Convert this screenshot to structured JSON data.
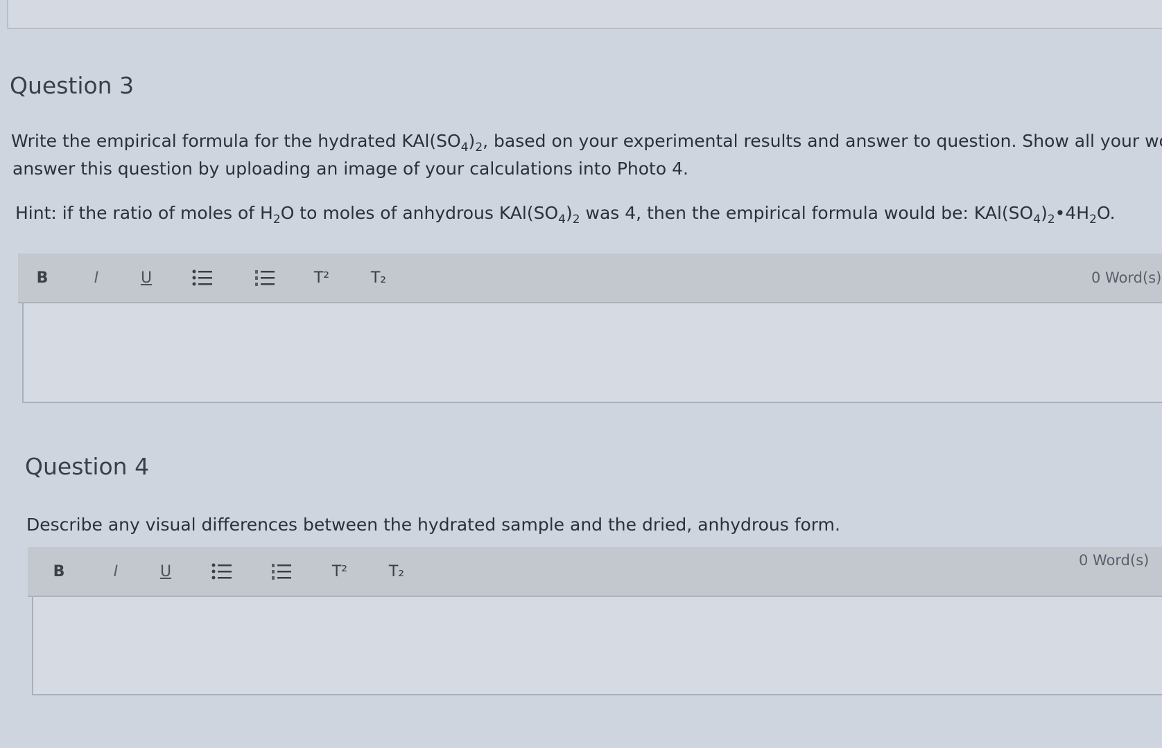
{
  "top_panel": {},
  "question3": {
    "title": "Question 3",
    "line1": "Write the empirical formula for the hydrated KAl(SO4)2, based on your experimental results and answer to question. Show all your work to",
    "line2": "answer this question by uploading an image of your calculations into Photo 4.",
    "hint": "Hint: if the ratio of moles of H2O to moles of anhydrous KAl(SO4)2 was 4, then the empirical formula would be: KAl(SO4)2•4H2O.",
    "toolbar": {
      "bold": "B",
      "italic": "I",
      "underline": "U",
      "superscript": "T²",
      "subscript": "T₂",
      "word_count": "0 Word(s)"
    }
  },
  "question4": {
    "title": "Question 4",
    "prompt": "Describe any visual differences between the hydrated sample and the dried, anhydrous form.",
    "toolbar": {
      "bold": "B",
      "italic": "I",
      "underline": "U",
      "superscript": "T²",
      "subscript": "T₂",
      "word_count": "0 Word(s)"
    }
  }
}
